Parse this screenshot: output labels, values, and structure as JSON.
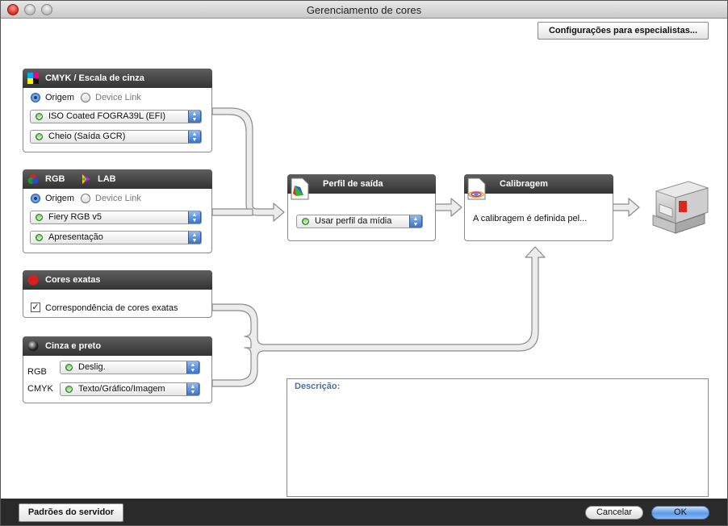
{
  "window": {
    "title": "Gerenciamento de cores"
  },
  "toolbar": {
    "expert_label": "Configurações para especialistas..."
  },
  "cmyk_panel": {
    "title": "CMYK / Escala de cinza",
    "radio_source": "Origem",
    "radio_devicelink": "Device Link",
    "profile_select": "ISO Coated FOGRA39L (EFI)",
    "gcr_select": "Cheio (Saída GCR)"
  },
  "rgb_panel": {
    "title_rgb": "RGB",
    "title_lab": "LAB",
    "radio_source": "Origem",
    "radio_devicelink": "Device Link",
    "profile_select": "Fiery RGB v5",
    "rendering_select": "Apresentação"
  },
  "spot_panel": {
    "title": "Cores exatas",
    "checkbox_label": "Correspondência de cores exatas",
    "checked": true
  },
  "gray_panel": {
    "title": "Cinza e preto",
    "rgb_label": "RGB",
    "rgb_select": "Deslig.",
    "cmyk_label": "CMYK",
    "cmyk_select": "Texto/Gráfico/Imagem"
  },
  "output_panel": {
    "title": "Perfil de saída",
    "select": "Usar perfil da mídia"
  },
  "calib_panel": {
    "title": "Calibragem",
    "text": "A calibragem é definida pel..."
  },
  "description": {
    "label": "Descrição:"
  },
  "footer": {
    "defaults_label": "Padrões do servidor",
    "cancel_label": "Cancelar",
    "ok_label": "OK"
  },
  "colors": {
    "accent_blue": "#3a72c8",
    "panel_header": "#3f3f3f",
    "arrow_fill": "#e6e6e6"
  }
}
